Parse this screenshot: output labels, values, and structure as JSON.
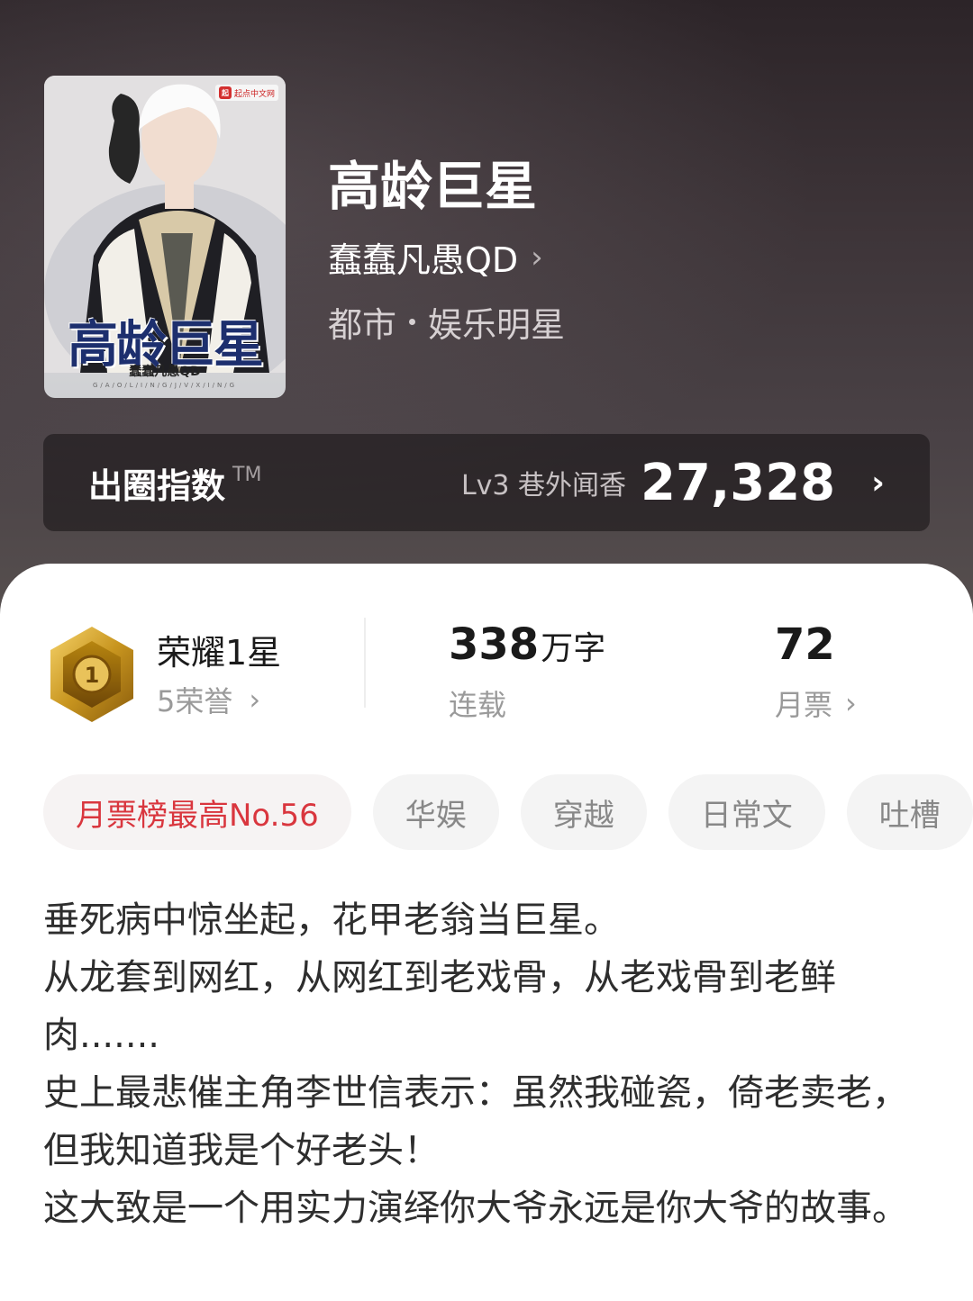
{
  "book": {
    "title": "高龄巨星",
    "author": "蠢蠢凡愚QD",
    "genre_main": "都市",
    "genre_sub": "娱乐明星"
  },
  "cover": {
    "title": "高龄巨星",
    "author": "蠢蠢凡愚QD",
    "pinyin": "G/A/O/L/I/N/G/J/V/X/I/N/G",
    "badge": "起点中文网"
  },
  "index_bar": {
    "label": "出圈指数",
    "tm": "TM",
    "level": "Lv3 巷外闻香",
    "score": "27,328"
  },
  "stats": {
    "honor_title": "荣耀1星",
    "honor_sub": "5荣誉",
    "words_num": "338",
    "words_unit": "万字",
    "status": "连载",
    "monthly_tickets": "72",
    "monthly_label": "月票"
  },
  "tags": [
    "月票榜最高No.56",
    "华娱",
    "穿越",
    "日常文",
    "吐槽"
  ],
  "description": [
    "垂死病中惊坐起，花甲老翁当巨星。",
    "从龙套到网红，从网红到老戏骨，从老戏骨到老鲜肉.......",
    "史上最悲催主角李世信表示：虽然我碰瓷，倚老卖老，但我知道我是个好老头！",
    "这大致是一个用实力演绎你大爷永远是你大爷的故事。"
  ]
}
